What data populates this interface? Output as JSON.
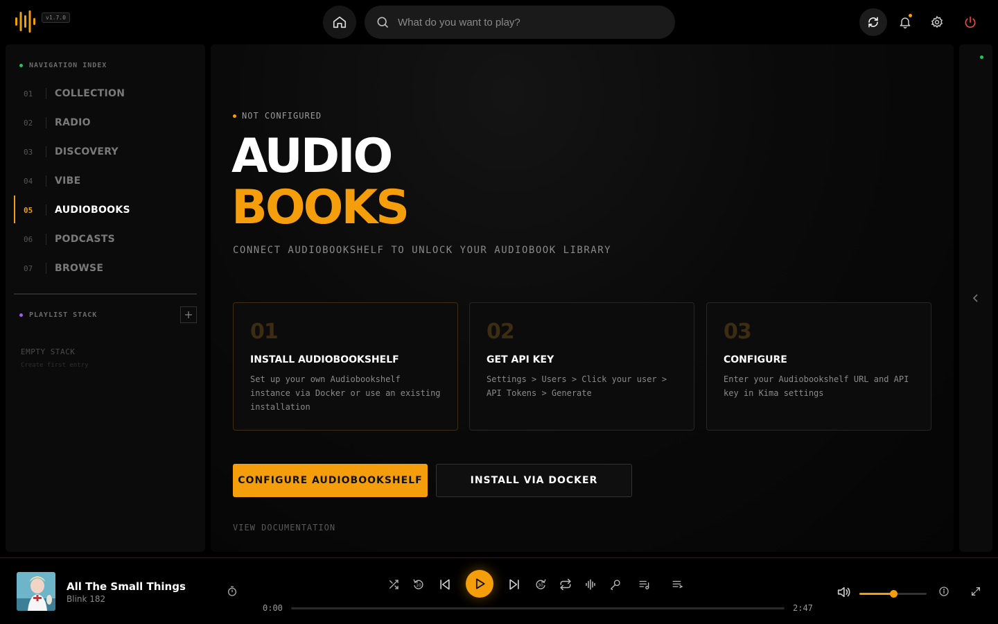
{
  "app": {
    "version": "v1.7.0",
    "accent": "#f59e0b"
  },
  "header": {
    "search_placeholder": "What do you want to play?",
    "icons": [
      "home-icon",
      "search-icon",
      "sync-icon",
      "bell-icon",
      "gear-icon",
      "power-icon"
    ]
  },
  "sidebar": {
    "nav_title": "NAVIGATION INDEX",
    "items": [
      {
        "num": "01",
        "label": "COLLECTION",
        "active": false
      },
      {
        "num": "02",
        "label": "RADIO",
        "active": false
      },
      {
        "num": "03",
        "label": "DISCOVERY",
        "active": false
      },
      {
        "num": "04",
        "label": "VIBE",
        "active": false
      },
      {
        "num": "05",
        "label": "AUDIOBOOKS",
        "active": true
      },
      {
        "num": "06",
        "label": "PODCASTS",
        "active": false
      },
      {
        "num": "07",
        "label": "BROWSE",
        "active": false
      }
    ],
    "playlist_title": "PLAYLIST STACK",
    "empty_title": "EMPTY STACK",
    "empty_sub": "Create first entry"
  },
  "main": {
    "status": "NOT CONFIGURED",
    "title_line1": "AUDIO",
    "title_line2": "BOOKS",
    "subtitle": "CONNECT AUDIOBOOKSHELF TO UNLOCK YOUR AUDIOBOOK LIBRARY",
    "steps": [
      {
        "num": "01",
        "title": "INSTALL AUDIOBOOKSHELF",
        "desc": "Set up your own Audiobookshelf instance via Docker or use an existing installation"
      },
      {
        "num": "02",
        "title": "GET API KEY",
        "desc": "Settings > Users > Click your user > API Tokens > Generate"
      },
      {
        "num": "03",
        "title": "CONFIGURE",
        "desc": "Enter your Audiobookshelf URL and API key in Kima settings"
      }
    ],
    "primary_button": "CONFIGURE AUDIOBOOKSHELF",
    "secondary_button": "INSTALL VIA DOCKER",
    "doc_link": "VIEW DOCUMENTATION"
  },
  "player": {
    "track_title": "All The Small Things",
    "track_artist": "Blink 182",
    "time_current": "0:00",
    "time_total": "2:47",
    "progress": 0,
    "volume": 0.5,
    "controls": [
      "shuffle-icon",
      "rewind-10-icon",
      "previous-icon",
      "play-icon",
      "next-icon",
      "forward-30-icon",
      "repeat-icon",
      "waveform-icon",
      "microphone-icon",
      "playlist-music-icon",
      "queue-icon"
    ]
  }
}
